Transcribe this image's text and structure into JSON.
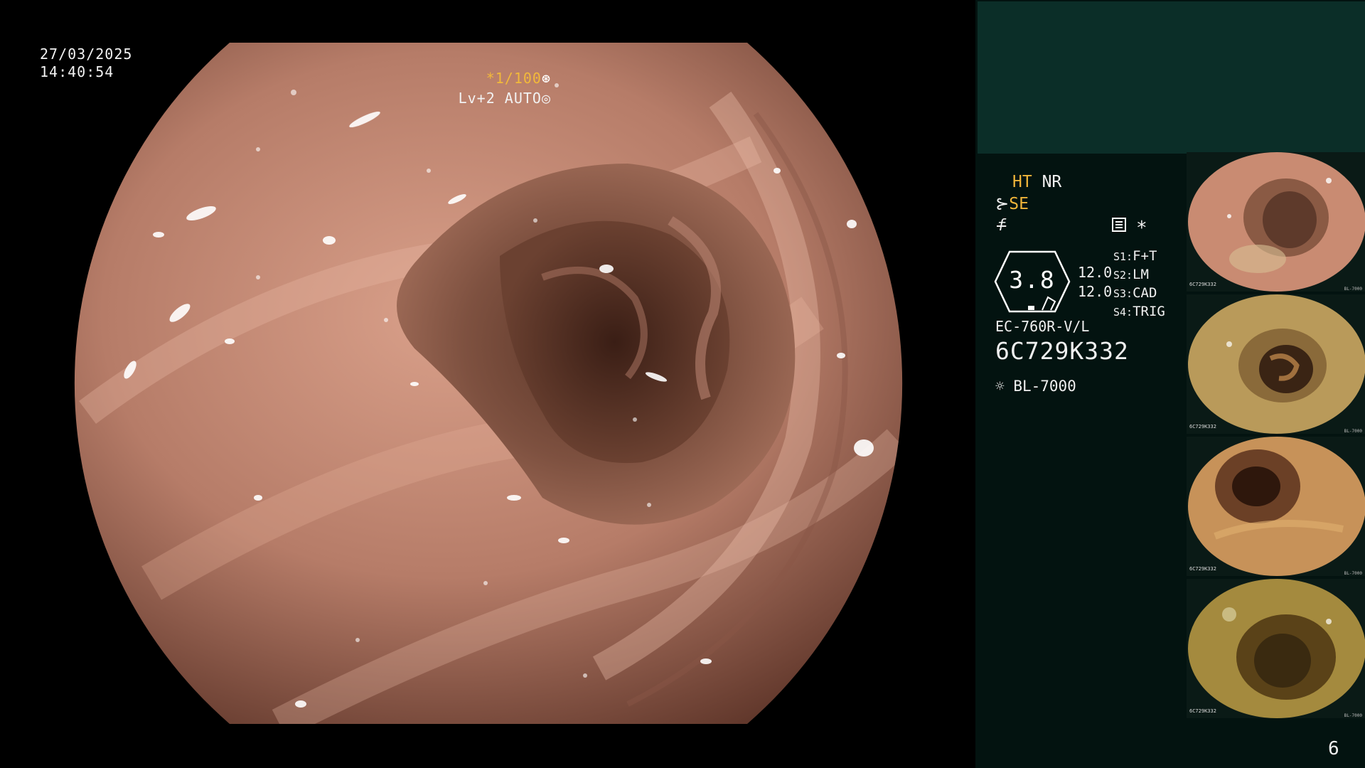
{
  "overlay": {
    "date": "27/03/2025",
    "time": "14:40:54",
    "shutter": "*1/100",
    "shutter_icon": "aperture-icon",
    "level": "Lv+2 AUTO",
    "level_icon": "iris-icon"
  },
  "panel": {
    "mode_ht": "HT",
    "mode_nr": "NR",
    "mode_se": "SE",
    "f_symbol": "f",
    "star_symbol": "*",
    "gauge_value": "3.8",
    "values": [
      "12.0",
      "12.0"
    ],
    "switches": [
      {
        "key": "S1:",
        "value": "F+T"
      },
      {
        "key": "S2:",
        "value": "LM"
      },
      {
        "key": "S3:",
        "value": "CAD"
      },
      {
        "key": "S4:",
        "value": "TRIG"
      }
    ],
    "scope_model": "EC-760R-V/L",
    "serial": "6C729K332",
    "light_source": "BL-7000",
    "page_number": "6"
  },
  "thumbnails": [
    {
      "label": "6C729K332",
      "footer": "BL-7000"
    },
    {
      "label": "6C729K332",
      "footer": "BL-7000"
    },
    {
      "label": "6C729K332",
      "footer": "BL-7000"
    },
    {
      "label": "6C729K332",
      "footer": "BL-7000"
    }
  ],
  "colors": {
    "panel_bg": "#031310",
    "header_bg": "#0b2e28",
    "accent_yellow": "#f0b53a",
    "mucosa": "#c48a76"
  }
}
